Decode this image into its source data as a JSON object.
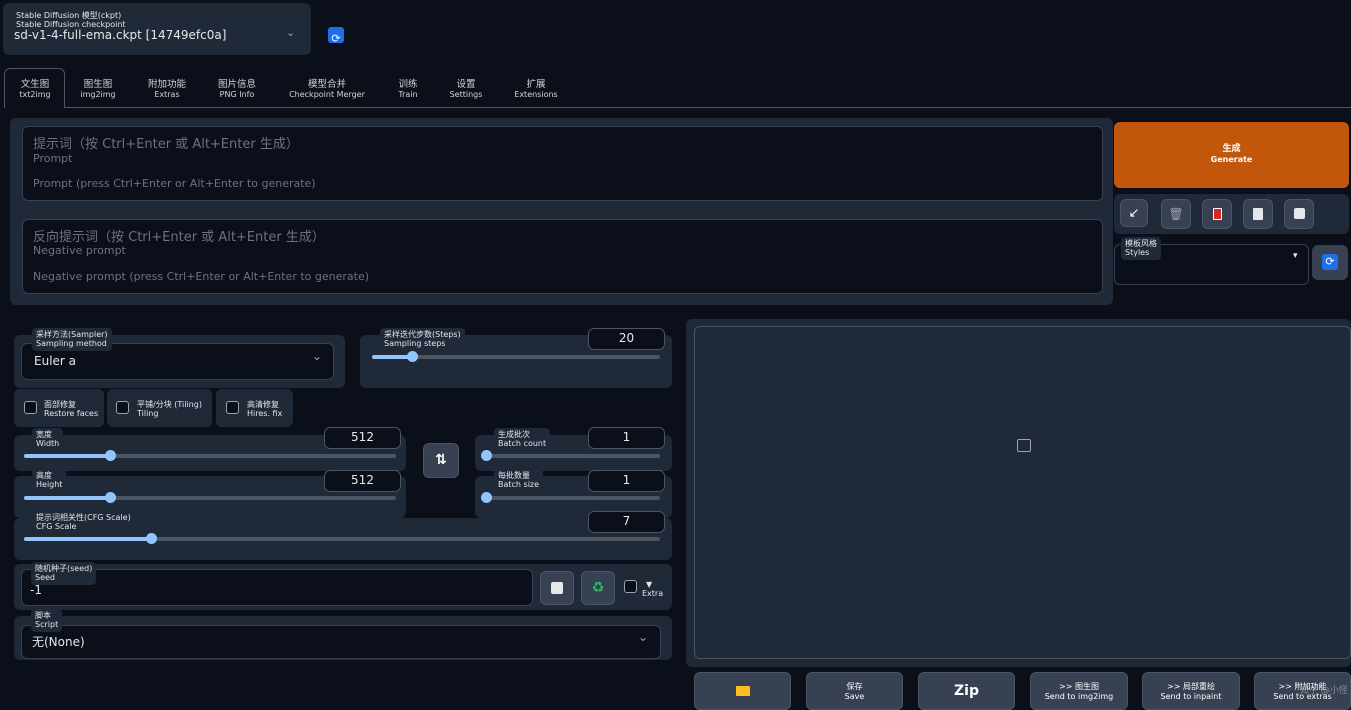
{
  "checkpoint": {
    "label_cn": "Stable Diffusion 模型(ckpt)",
    "label_en": "Stable Diffusion checkpoint",
    "value": "sd-v1-4-full-ema.ckpt [14749efc0a]"
  },
  "tabs": [
    {
      "cn": "文生图",
      "en": "txt2img"
    },
    {
      "cn": "图生图",
      "en": "img2img"
    },
    {
      "cn": "附加功能",
      "en": "Extras"
    },
    {
      "cn": "图片信息",
      "en": "PNG Info"
    },
    {
      "cn": "模型合并",
      "en": "Checkpoint Merger"
    },
    {
      "cn": "训练",
      "en": "Train"
    },
    {
      "cn": "设置",
      "en": "Settings"
    },
    {
      "cn": "扩展",
      "en": "Extensions"
    }
  ],
  "prompt": {
    "label_cn": "提示词（按 Ctrl+Enter 或 Alt+Enter 生成）",
    "label_en": "Prompt",
    "placeholder": "Prompt (press Ctrl+Enter or Alt+Enter to generate)"
  },
  "negative_prompt": {
    "label_cn": "反向提示词（按 Ctrl+Enter 或 Alt+Enter 生成）",
    "label_en": "Negative prompt",
    "placeholder": "Negative prompt (press Ctrl+Enter or Alt+Enter to generate)"
  },
  "generate": {
    "cn": "生成",
    "en": "Generate"
  },
  "styles": {
    "label_cn": "模板风格",
    "label_en": "Styles"
  },
  "sampler": {
    "label_cn": "采样方法(Sampler)",
    "label_en": "Sampling method",
    "value": "Euler a"
  },
  "steps": {
    "label_cn": "采样迭代步数(Steps)",
    "label_en": "Sampling steps",
    "value": "20",
    "fraction": 0.14
  },
  "checkboxes": {
    "restore_faces": {
      "cn": "面部修复",
      "en": "Restore faces"
    },
    "tiling": {
      "cn": "平铺/分块 (Tiling)",
      "en": "Tiling"
    },
    "hires_fix": {
      "cn": "高清修复",
      "en": "Hires. fix"
    }
  },
  "width": {
    "label_cn": "宽度",
    "label_en": "Width",
    "value": "512",
    "fraction": 0.23
  },
  "height": {
    "label_cn": "高度",
    "label_en": "Height",
    "value": "512",
    "fraction": 0.23
  },
  "batch_count": {
    "label_cn": "生成批次",
    "label_en": "Batch count",
    "value": "1",
    "fraction": 0.0
  },
  "batch_size": {
    "label_cn": "每批数量",
    "label_en": "Batch size",
    "value": "1",
    "fraction": 0.0
  },
  "cfg": {
    "label_cn": "提示词相关性(CFG Scale)",
    "label_en": "CFG Scale",
    "value": "7",
    "fraction": 0.2
  },
  "seed": {
    "label_cn": "随机种子(seed)",
    "label_en": "Seed",
    "value": "-1",
    "extra": "Extra"
  },
  "script": {
    "label_cn": "脚本",
    "label_en": "Script",
    "value": "无(None)"
  },
  "output_buttons": {
    "save": {
      "cn": "保存",
      "en": "Save"
    },
    "zip": "Zip",
    "img2img": {
      "cn": ">> 图生图",
      "en": "Send to img2img"
    },
    "inpaint": {
      "cn": ">> 局部重绘",
      "en": "Send to inpaint"
    },
    "extras": {
      "cn": ">> 附加功能",
      "en": "Send to extras"
    }
  },
  "watermark": "知乎 @小怪",
  "colors": {
    "generate": "#c2570c",
    "accent": "#93c5fd",
    "refresh": "#1f6feb"
  }
}
